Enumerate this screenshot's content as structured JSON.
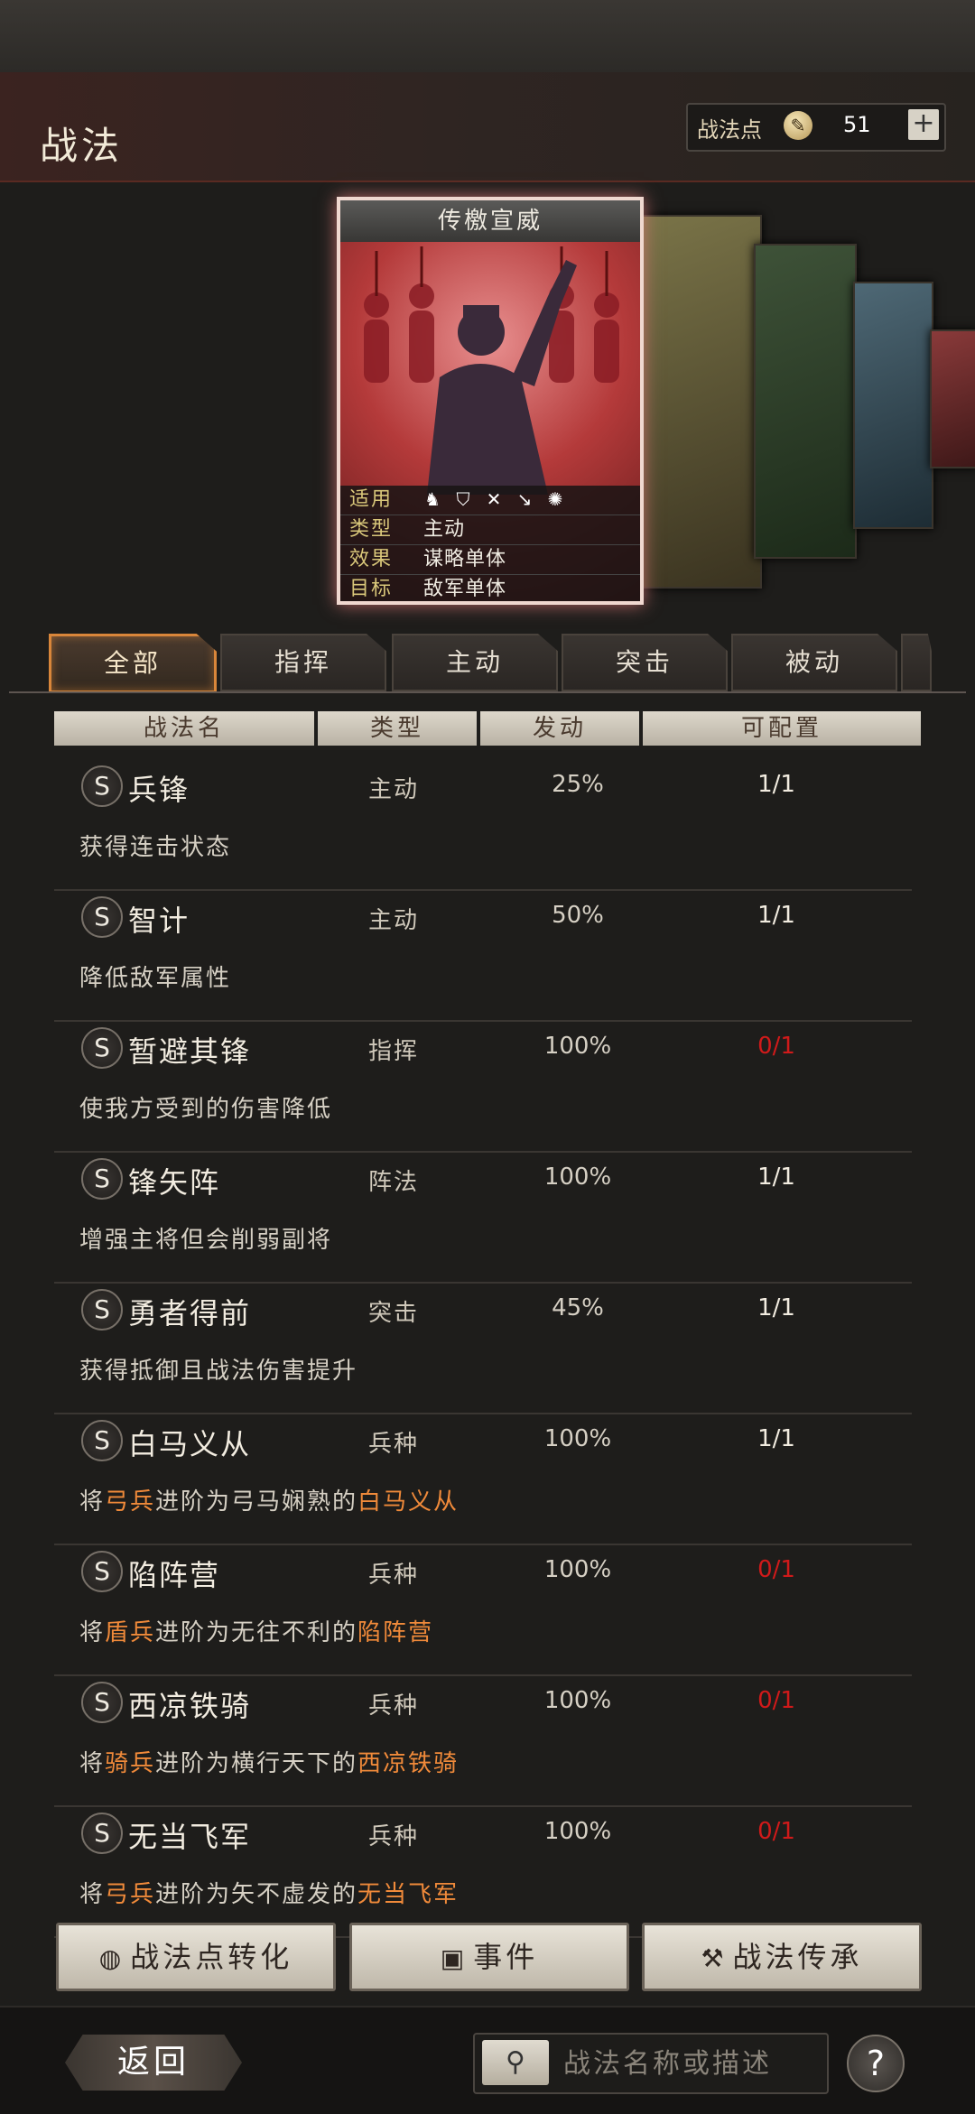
{
  "header": {
    "title": "战法",
    "points_label": "战法点",
    "points_icon": "coin-icon",
    "points_value": "51",
    "add_label": "+"
  },
  "card": {
    "name": "传檄宣威",
    "applicable_label": "适用",
    "type_label": "类型",
    "type_value": "主动",
    "effect_label": "效果",
    "effect_value": "谋略单体",
    "target_label": "目标",
    "target_value": "敌军单体",
    "applicable_icons": [
      "cavalry-icon",
      "shield-icon",
      "bow-icon",
      "spear-icon",
      "wheel-icon"
    ]
  },
  "tabs": [
    "全部",
    "指挥",
    "主动",
    "突击",
    "被动"
  ],
  "table": {
    "headers": [
      "战法名",
      "类型",
      "发动",
      "可配置"
    ],
    "rows": [
      {
        "badge": "S",
        "name": "兵锋",
        "type": "主动",
        "rate": "25%",
        "config": "1/1",
        "available": true,
        "desc": "获得连击状态"
      },
      {
        "badge": "S",
        "name": "智计",
        "type": "主动",
        "rate": "50%",
        "config": "1/1",
        "available": true,
        "desc": "降低敌军属性"
      },
      {
        "badge": "S",
        "name": "暂避其锋",
        "type": "指挥",
        "rate": "100%",
        "config": "0/1",
        "available": false,
        "desc": "使我方受到的伤害降低"
      },
      {
        "badge": "S",
        "name": "锋矢阵",
        "type": "阵法",
        "rate": "100%",
        "config": "1/1",
        "available": true,
        "desc": "增强主将但会削弱副将"
      },
      {
        "badge": "S",
        "name": "勇者得前",
        "type": "突击",
        "rate": "45%",
        "config": "1/1",
        "available": true,
        "desc": "获得抵御且战法伤害提升"
      },
      {
        "badge": "S",
        "name": "白马义从",
        "type": "兵种",
        "rate": "100%",
        "config": "1/1",
        "available": true,
        "desc_parts": [
          "将",
          "弓兵",
          "进阶为弓马娴熟的",
          "白马义从"
        ]
      },
      {
        "badge": "S",
        "name": "陷阵营",
        "type": "兵种",
        "rate": "100%",
        "config": "0/1",
        "available": false,
        "desc_parts": [
          "将",
          "盾兵",
          "进阶为无往不利的",
          "陷阵营"
        ]
      },
      {
        "badge": "S",
        "name": "西凉铁骑",
        "type": "兵种",
        "rate": "100%",
        "config": "0/1",
        "available": false,
        "desc_parts": [
          "将",
          "骑兵",
          "进阶为横行天下的",
          "西凉铁骑"
        ]
      },
      {
        "badge": "S",
        "name": "无当飞军",
        "type": "兵种",
        "rate": "100%",
        "config": "0/1",
        "available": false,
        "desc_parts": [
          "将",
          "弓兵",
          "进阶为矢不虚发的",
          "无当飞军"
        ]
      }
    ]
  },
  "buttons": {
    "convert": "战法点转化",
    "event": "事件",
    "inherit": "战法传承"
  },
  "footer": {
    "back": "返回",
    "search_placeholder": "战法名称或描述",
    "help": "?"
  },
  "colors": {
    "accent": "#d9863a",
    "highlight": "#f08a3a",
    "unavailable": "#d01a1a"
  }
}
